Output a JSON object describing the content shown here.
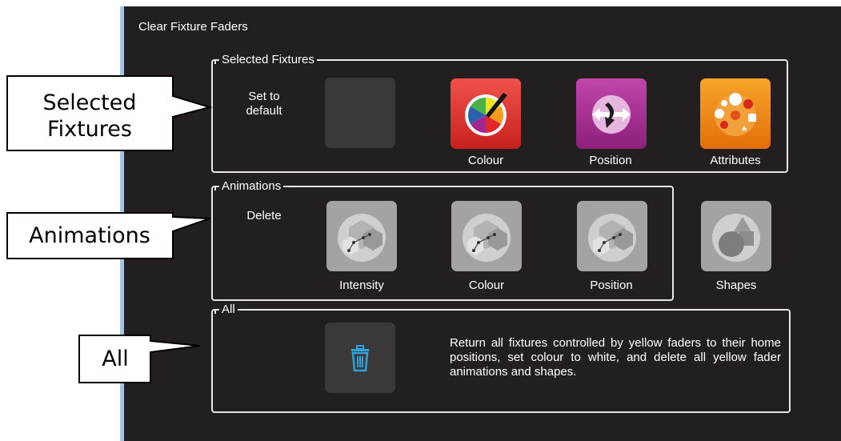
{
  "dialog": {
    "title": "Clear Fixture Faders"
  },
  "selected_fixtures": {
    "legend": "Selected Fixtures",
    "side_label": "Set to\ndefault",
    "tiles": [
      {
        "label": "",
        "icon": "blank-tile"
      },
      {
        "label": "Colour",
        "icon": "colour-wheel-icon"
      },
      {
        "label": "Position",
        "icon": "position-icon"
      },
      {
        "label": "Attributes",
        "icon": "attributes-icon"
      }
    ]
  },
  "animations": {
    "legend": "Animations",
    "side_label": "Delete",
    "tiles": [
      {
        "label": "Intensity",
        "icon": "animation-icon"
      },
      {
        "label": "Colour",
        "icon": "animation-icon"
      },
      {
        "label": "Position",
        "icon": "animation-icon"
      }
    ],
    "shapes": {
      "label": "Shapes",
      "icon": "shapes-icon"
    }
  },
  "all": {
    "legend": "All",
    "button_icon": "trash-icon",
    "description": "Return all fixtures controlled by yellow faders to their home positions, set colour to white, and delete all yellow fader animations and shapes."
  },
  "callouts": {
    "selected_fixtures": "Selected\nFixtures",
    "animations": "Animations",
    "all": "All"
  },
  "colors": {
    "panel_bg": "#231f20",
    "colour_tile": "#e0302c",
    "position_tile": "#a4278f",
    "attributes_tile": "#f08a12",
    "animation_tile": "#9a9a9a",
    "trash_icon": "#2ea3dc"
  }
}
